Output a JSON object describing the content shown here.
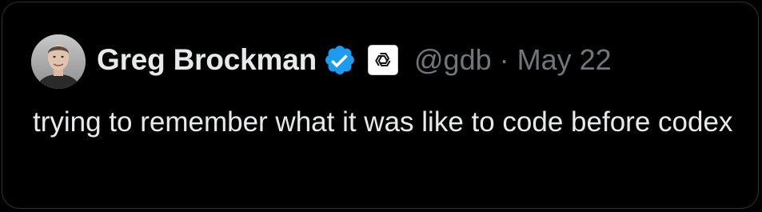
{
  "tweet": {
    "author": {
      "display_name": "Greg Brockman",
      "handle": "@gdb",
      "verified_icon": "verified-badge-icon",
      "affiliate_icon": "openai-logo-icon",
      "avatar": "profile-photo"
    },
    "separator": "·",
    "date": "May 22",
    "text": "trying to remember what it was like to code before codex"
  },
  "colors": {
    "background": "#000000",
    "border": "#2f3336",
    "primary_text": "#e7e9ea",
    "secondary_text": "#71767b",
    "verified_blue": "#1d9bf0"
  }
}
